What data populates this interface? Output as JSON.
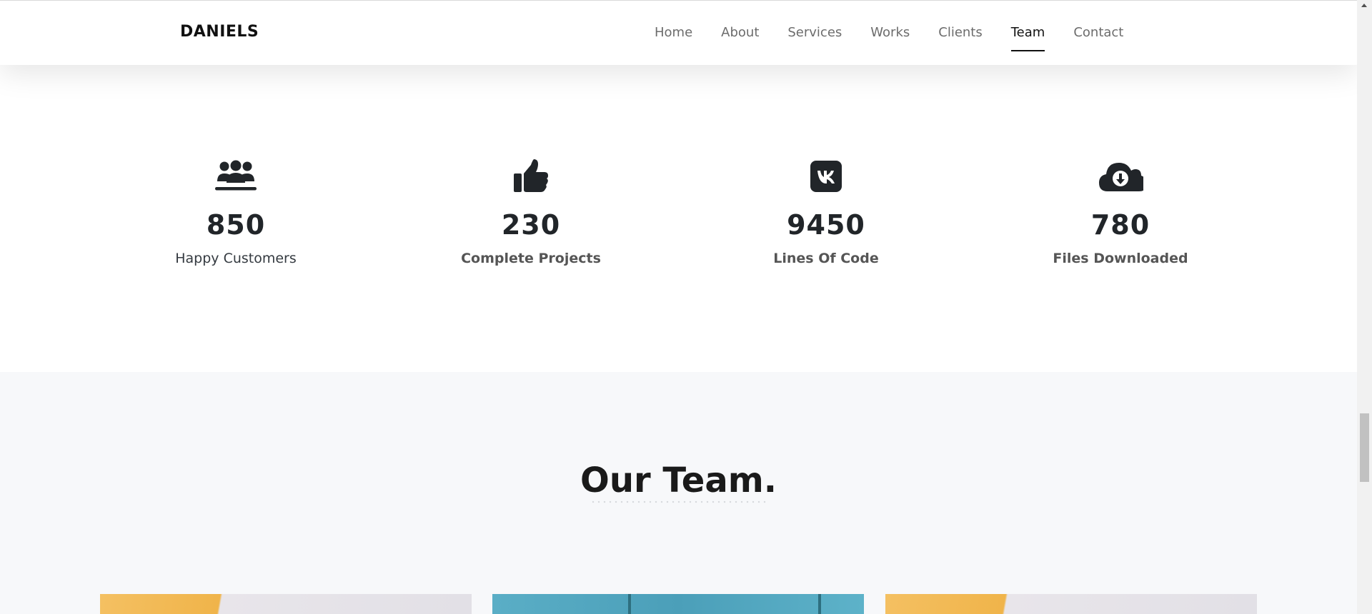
{
  "header": {
    "brand": "DANIELS",
    "nav": [
      {
        "label": "Home",
        "active": false
      },
      {
        "label": "About",
        "active": false
      },
      {
        "label": "Services",
        "active": false
      },
      {
        "label": "Works",
        "active": false
      },
      {
        "label": "Clients",
        "active": false
      },
      {
        "label": "Team",
        "active": true
      },
      {
        "label": "Contact",
        "active": false
      }
    ]
  },
  "counters": [
    {
      "icon": "users-icon",
      "value": "850",
      "label": "Happy Customers"
    },
    {
      "icon": "thumbs-up-icon",
      "value": "230",
      "label": "Complete Projects"
    },
    {
      "icon": "vk-icon",
      "value": "9450",
      "label": "Lines Of Code"
    },
    {
      "icon": "cloud-download-icon",
      "value": "780",
      "label": "Files Downloaded"
    }
  ],
  "team": {
    "title": "Our Team."
  },
  "colors": {
    "text_dark": "#212529",
    "team_bg": "#f7f8fa",
    "accent_yellow": "#f0b44a",
    "accent_teal": "#4b9fb9"
  }
}
